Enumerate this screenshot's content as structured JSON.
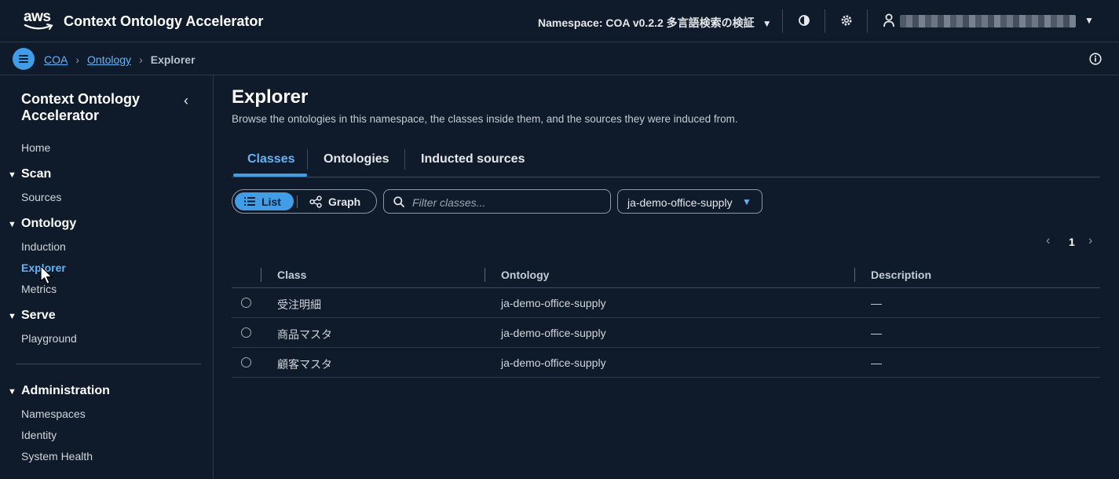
{
  "topnav": {
    "logo_text": "aws",
    "app_title": "Context Ontology Accelerator",
    "namespace_label": "Namespace: COA v0.2.2 多言語検索の検証",
    "caret": "▼"
  },
  "breadcrumb": {
    "items": [
      "COA",
      "Ontology"
    ],
    "current": "Explorer",
    "separator": "›"
  },
  "sidebar": {
    "title": "Context Ontology Accelerator",
    "collapse": "‹",
    "home": "Home",
    "sections": [
      {
        "label": "Scan",
        "items": [
          "Sources"
        ]
      },
      {
        "label": "Ontology",
        "items": [
          "Induction",
          "Explorer",
          "Metrics"
        ],
        "active": "Explorer"
      },
      {
        "label": "Serve",
        "items": [
          "Playground"
        ]
      },
      {
        "label": "Administration",
        "items": [
          "Namespaces",
          "Identity",
          "System Health"
        ]
      }
    ],
    "triangle": "▼"
  },
  "main": {
    "title": "Explorer",
    "description": "Browse the ontologies in this namespace, the classes inside them, and the sources they were induced from.",
    "tabs": [
      "Classes",
      "Ontologies",
      "Inducted sources"
    ],
    "active_tab": "Classes",
    "view_toggle": {
      "list": "List",
      "graph": "Graph",
      "selected": "List"
    },
    "filter_placeholder": "Filter classes...",
    "ontology_select": "ja-demo-office-supply",
    "pagination": {
      "prev": "‹",
      "page": "1",
      "next": "›"
    },
    "table": {
      "headers": [
        "Class",
        "Ontology",
        "Description"
      ],
      "rows": [
        {
          "class": "受注明細",
          "ontology": "ja-demo-office-supply",
          "description": "—"
        },
        {
          "class": "商品マスタ",
          "ontology": "ja-demo-office-supply",
          "description": "—"
        },
        {
          "class": "顧客マスタ",
          "ontology": "ja-demo-office-supply",
          "description": "—"
        }
      ]
    }
  },
  "colors": {
    "background": "#0f1b2a",
    "accent": "#3f9ee8",
    "link": "#61b5f5",
    "border": "#3b4a5c"
  }
}
